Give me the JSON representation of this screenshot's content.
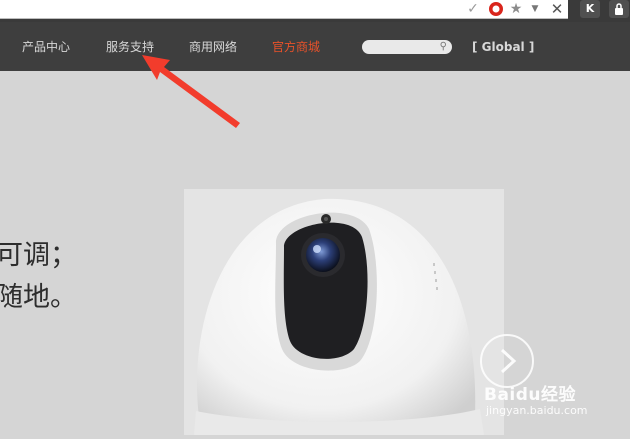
{
  "browser": {
    "icons": [
      "checkmark-icon",
      "adblock-icon",
      "bookmark-star-icon",
      "dropdown-arrow-icon",
      "close-icon"
    ],
    "extension_k": "K",
    "accent_red": "#d9251c"
  },
  "nav": {
    "items": [
      {
        "label": "产品中心",
        "active": false
      },
      {
        "label": "服务支持",
        "active": false
      },
      {
        "label": "商用网络",
        "active": false
      },
      {
        "label": "官方商城",
        "active": true
      }
    ],
    "search_placeholder": "",
    "global_label": "[ Global ]",
    "active_color": "#e8522a"
  },
  "hero": {
    "line1": "可调；",
    "line2": "随地。"
  },
  "product": {
    "name": "camera-image"
  },
  "watermark": {
    "brand": "Baidu经验",
    "url": "jingyan.baidu.com"
  },
  "annotation": {
    "arrow_color": "#f23c2c"
  }
}
